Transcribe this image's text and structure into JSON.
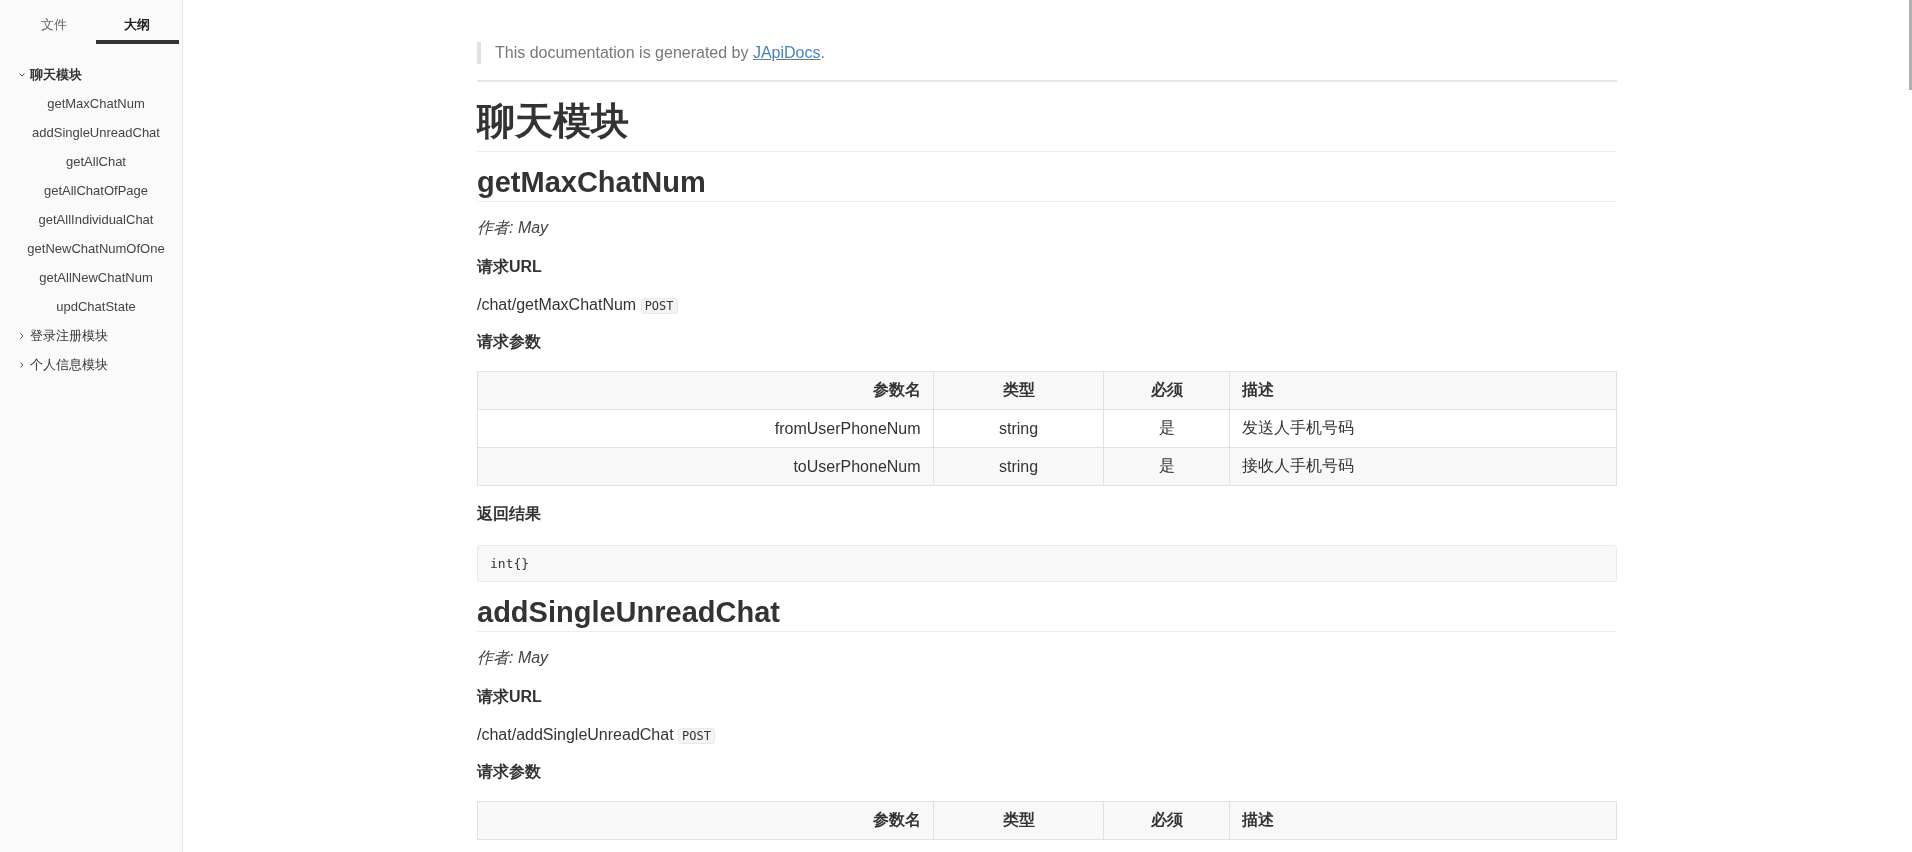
{
  "sidebar": {
    "tabs": [
      {
        "label": "文件",
        "selected": false
      },
      {
        "label": "大纲",
        "selected": true
      }
    ],
    "outline": [
      {
        "label": "聊天模块",
        "expanded": true,
        "children": [
          {
            "label": "getMaxChatNum"
          },
          {
            "label": "addSingleUnreadChat"
          },
          {
            "label": "getAllChat"
          },
          {
            "label": "getAllChatOfPage"
          },
          {
            "label": "getAllIndividualChat"
          },
          {
            "label": "getNewChatNumOfOne"
          },
          {
            "label": "getAllNewChatNum"
          },
          {
            "label": "updChatState"
          }
        ]
      },
      {
        "label": "登录注册模块",
        "expanded": false
      },
      {
        "label": "个人信息模块",
        "expanded": false
      }
    ]
  },
  "doc": {
    "note": {
      "text": "This documentation is generated by",
      "link": "JApiDocs",
      "suffix": "."
    },
    "title": "聊天模块",
    "sections": [
      {
        "name": "getMaxChatNum",
        "author": "作者: May",
        "url_heading": "请求URL",
        "url": "/chat/getMaxChatNum",
        "method": "POST",
        "params_heading": "请求参数",
        "table": {
          "columns": [
            "参数名",
            "类型",
            "必须",
            "描述"
          ],
          "rows": [
            [
              "fromUserPhoneNum",
              "string",
              "是",
              "发送人手机号码"
            ],
            [
              "toUserPhoneNum",
              "string",
              "是",
              "接收人手机号码"
            ]
          ]
        },
        "result_heading": "返回结果",
        "result_code": "int{}"
      },
      {
        "name": "addSingleUnreadChat",
        "author": "作者: May",
        "url_heading": "请求URL",
        "url": "/chat/addSingleUnreadChat",
        "method": "POST",
        "params_heading": "请求参数",
        "table": {
          "columns": [
            "参数名",
            "类型",
            "必须",
            "描述"
          ]
        }
      }
    ]
  }
}
